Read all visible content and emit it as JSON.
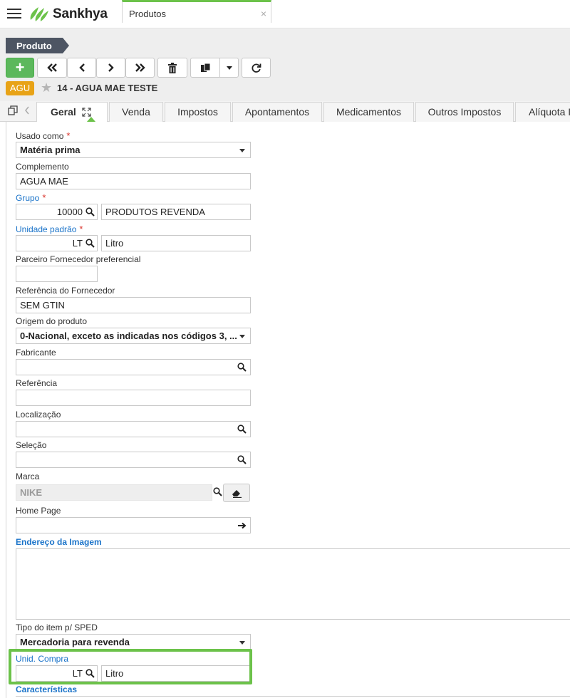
{
  "app": {
    "brand": "Sankhya",
    "tab_label": "Produtos",
    "tab_close": "×"
  },
  "breadcrumb": "Produto",
  "toolbar": {
    "add_label": "+"
  },
  "record": {
    "badge": "AGU",
    "title": "14 - AGUA MAE TESTE"
  },
  "tabs": [
    "Geral",
    "Venda",
    "Impostos",
    "Apontamentos",
    "Medicamentos",
    "Outros Impostos",
    "Alíquota I"
  ],
  "form": {
    "usado_como": {
      "label": "Usado como",
      "value": "Matéria prima"
    },
    "complemento": {
      "label": "Complemento",
      "value": "AGUA MAE"
    },
    "grupo": {
      "label": "Grupo",
      "code": "10000",
      "desc": "PRODUTOS REVENDA"
    },
    "unidade_padrao": {
      "label": "Unidade padrão",
      "code": "LT",
      "desc": "Litro"
    },
    "parceiro_fornecedor": {
      "label": "Parceiro Fornecedor preferencial",
      "value": ""
    },
    "referencia_fornecedor": {
      "label": "Referência do Fornecedor",
      "value": "SEM GTIN"
    },
    "origem_produto": {
      "label": "Origem do produto",
      "value": "0-Nacional, exceto as indicadas nos códigos 3, ..."
    },
    "fabricante": {
      "label": "Fabricante",
      "value": ""
    },
    "referencia": {
      "label": "Referência",
      "value": ""
    },
    "localizacao": {
      "label": "Localização",
      "value": ""
    },
    "selecao": {
      "label": "Seleção",
      "value": ""
    },
    "marca": {
      "label": "Marca",
      "value": "NIKE"
    },
    "home_page": {
      "label": "Home Page",
      "value": ""
    },
    "endereco_imagem": {
      "label": "Endereço da Imagem"
    },
    "tipo_item_sped": {
      "label": "Tipo do item p/ SPED",
      "value": "Mercadoria para revenda"
    },
    "unid_compra": {
      "label": "Unid. Compra",
      "code": "LT",
      "desc": "Litro"
    },
    "caracteristicas": {
      "label": "Características"
    }
  },
  "colors": {
    "accent_green": "#6cc24a",
    "add_button": "#5cb85c",
    "badge": "#e8a317",
    "link_blue": "#1a73c9",
    "breadcrumb_bg": "#4d5563"
  }
}
